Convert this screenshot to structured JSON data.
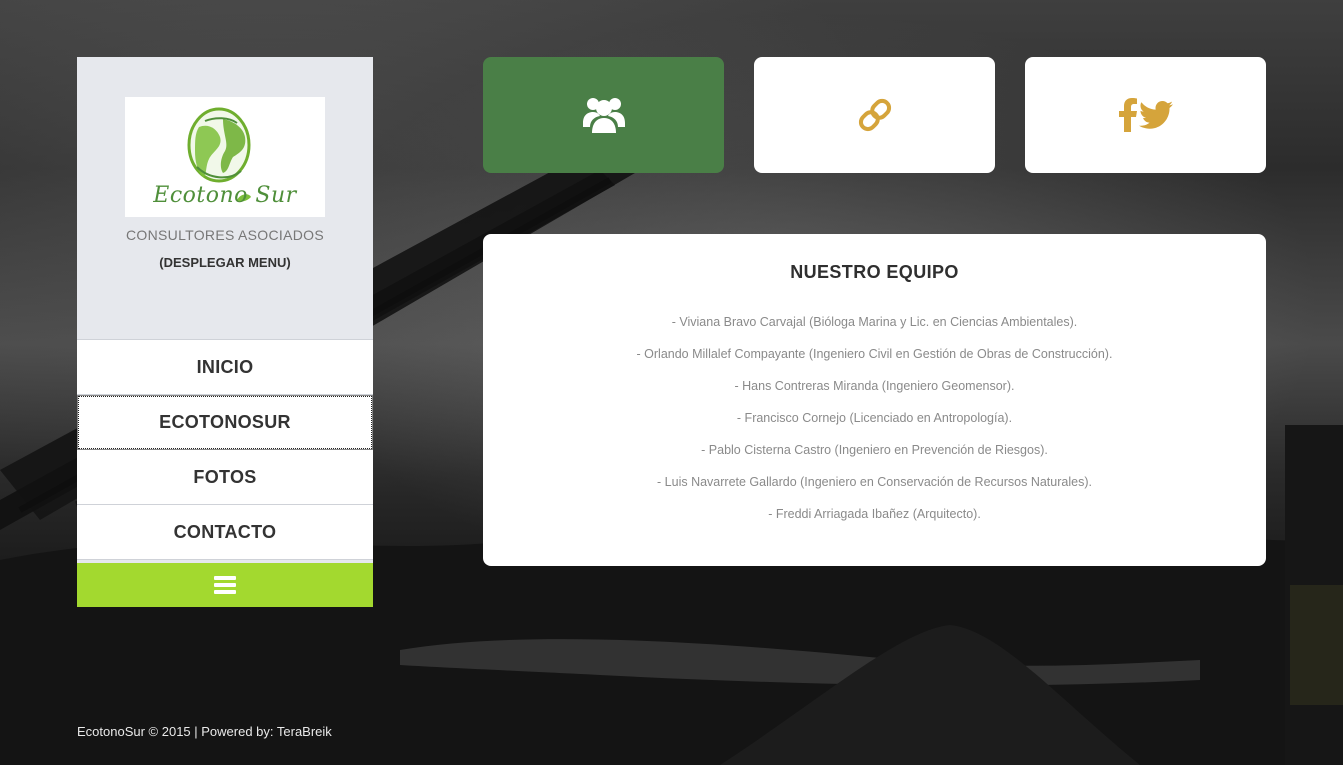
{
  "brand": {
    "logo_text": "Ecotono Sur",
    "tagline": "CONSULTORES ASOCIADOS",
    "menu_toggle": "(DESPLEGAR MENU)"
  },
  "nav": {
    "items": [
      {
        "label": "INICIO"
      },
      {
        "label": "ECOTONOSUR"
      },
      {
        "label": "FOTOS"
      },
      {
        "label": "CONTACTO"
      }
    ],
    "active_item": "ECOTONOSUR"
  },
  "top_cards": [
    {
      "icon": "users-icon",
      "color": "#4a7f47"
    },
    {
      "icon": "link-icon",
      "color": "#ffffff"
    },
    {
      "icon": "social-icons",
      "color": "#ffffff"
    }
  ],
  "panel": {
    "title": "NUESTRO EQUIPO",
    "members": [
      "- Viviana Bravo Carvajal (Bióloga Marina y Lic. en Ciencias Ambientales).",
      "- Orlando Millalef Compayante (Ingeniero Civil en Gestión de Obras de Construcción).",
      "- Hans Contreras Miranda (Ingeniero Geomensor).",
      "- Francisco Cornejo (Licenciado en Antropología).",
      "- Pablo Cisterna Castro (Ingeniero en Prevención de Riesgos).",
      "- Luis Navarrete Gallardo (Ingeniero en Conservación de Recursos Naturales).",
      "- Freddi Arriagada Ibañez (Arquitecto)."
    ]
  },
  "footer": {
    "text": "EcotonoSur © 2015 | Powered by: TeraBreik"
  },
  "colors": {
    "accent_green": "#4a7f47",
    "lime": "#a3d92f",
    "icon_gold": "#d5a43b",
    "sidebar_bg": "#e6e8ed"
  }
}
